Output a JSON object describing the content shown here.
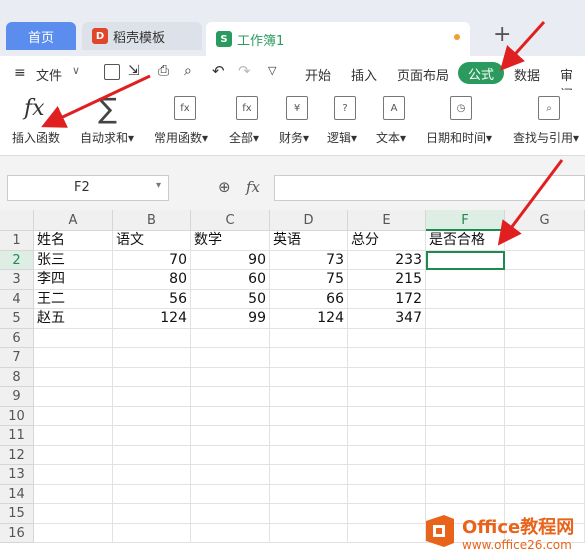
{
  "tabs": [
    {
      "label": "首页"
    },
    {
      "label": "稻壳模板"
    },
    {
      "label": "工作簿1"
    }
  ],
  "new_tab": "+",
  "menu": {
    "file": "文件",
    "items": [
      "开始",
      "插入",
      "页面布局",
      "公式",
      "数据",
      "审阅"
    ]
  },
  "ribbon": [
    "插入函数",
    "自动求和",
    "常用函数",
    "全部",
    "财务",
    "逻辑",
    "文本",
    "日期和时间",
    "查找与引用"
  ],
  "namebox": "F2",
  "fx": "fx",
  "columns": [
    "A",
    "B",
    "C",
    "D",
    "E",
    "F",
    "G"
  ],
  "rows": [
    "1",
    "2",
    "3",
    "4",
    "5",
    "6",
    "7",
    "8",
    "9",
    "10",
    "11",
    "12",
    "13",
    "14",
    "15",
    "16"
  ],
  "table": [
    [
      "姓名",
      "语文",
      "数学",
      "英语",
      "总分",
      "是否合格"
    ],
    [
      "张三",
      "70",
      "90",
      "73",
      "233",
      ""
    ],
    [
      "李四",
      "80",
      "60",
      "75",
      "215",
      ""
    ],
    [
      "王二",
      "56",
      "50",
      "66",
      "172",
      ""
    ],
    [
      "赵五",
      "124",
      "99",
      "124",
      "347",
      ""
    ]
  ],
  "watermark": {
    "text": "Office教程网",
    "url": "www.office26.com"
  },
  "colors": {
    "accent": "#2b9a5e",
    "arrow": "#e02020",
    "home_tab": "#5b8def"
  }
}
